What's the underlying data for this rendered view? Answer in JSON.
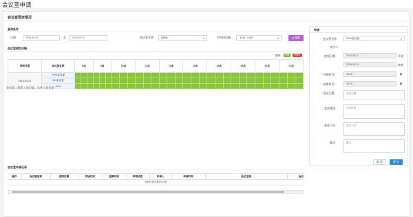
{
  "page": {
    "title": "会议室申请"
  },
  "section": {
    "title": "会议室预定情况"
  },
  "query": {
    "title": "查询条件",
    "date_label": "日期:",
    "date_from": "2018-05-31",
    "date_sep": "至",
    "date_to": "2018-05-31",
    "room_label": "会议室名称:",
    "room_value": "(全部)",
    "time_label": "时间段范围:",
    "time_value": "【9点--18点】",
    "search_label": "搜索"
  },
  "schedule": {
    "title": "会议室预定详情",
    "legend_label": "图例:",
    "legend_free": "可用",
    "legend_busy": "已预订",
    "col_date": "使用日期",
    "col_room": "会议室名称",
    "hours": [
      "9点",
      "9点",
      "10点",
      "11点",
      "12点",
      "13点",
      "14点",
      "15点",
      "16点",
      "17点"
    ],
    "date": "2018-05-31",
    "rooms": [
      "304A会议室",
      "302会议室",
      "404A"
    ],
    "footer": "显示第 1 到第 3 条记录，总共 3 条记录"
  },
  "records": {
    "title": "会议室申请记录",
    "columns": [
      "操作",
      "会议室名称",
      "使用日期",
      "开始时间",
      "结束时间",
      "审核状态",
      "申请人",
      "申请时间",
      "会议主题",
      "会议"
    ],
    "empty_text": "没有找到匹配的记录"
  },
  "apply": {
    "title": "申请",
    "room_label": "会议室名称:",
    "room_value": "304A会议室",
    "clerk_label": "文件人:",
    "date_label": "使用日期:",
    "date_value": "2018-05-31",
    "start_word": "开始",
    "end_date_value": "2018-05-31",
    "end_word": "结束",
    "start_time_label": "* 开始时间:",
    "start_time_value": "09:00",
    "end_time_label": "* 结束时间:",
    "end_time_value": "18:00",
    "subject_label": "* 会议主题:",
    "subject_placeholder": "会议主题",
    "desc_label": "会议描述:",
    "desc_placeholder": "会议描述",
    "participants_label": "参会人员:",
    "participants_placeholder": "参会人员",
    "remark_label": "备注:",
    "remark_placeholder": "备注",
    "cancel_label": "取 消",
    "submit_label": "提 交"
  },
  "colors": {
    "available": "#8cc43c",
    "booked": "#e2443b",
    "accent": "#2f86d9",
    "search": "#b565ce"
  }
}
